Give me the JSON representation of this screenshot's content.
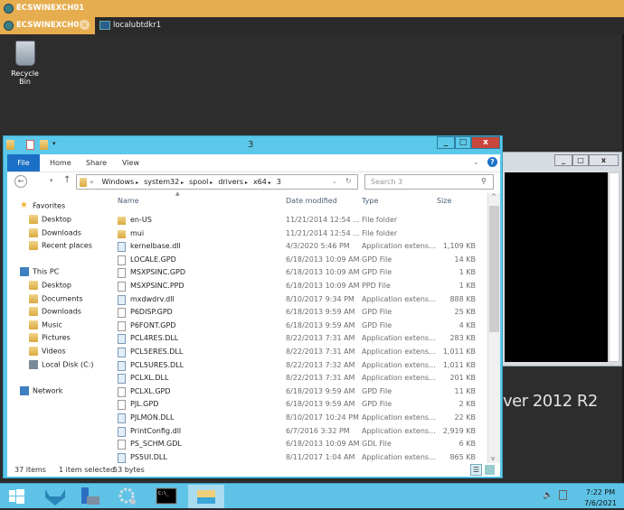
{
  "rdp": {
    "title": "ECSWINEXCH01",
    "tabs": [
      {
        "label": "ECSWINEXCH01",
        "active": true
      },
      {
        "label": "localubtdkr1",
        "active": false
      }
    ]
  },
  "desktop": {
    "recycle_bin": "Recycle Bin",
    "bg_text": "ver 2012 R2"
  },
  "explorer": {
    "title": "3",
    "ribbon": {
      "file": "File",
      "tabs": [
        "Home",
        "Share",
        "View"
      ]
    },
    "breadcrumb": [
      "Windows",
      "system32",
      "spool",
      "drivers",
      "x64",
      "3"
    ],
    "breadcrumb_prefix": "«",
    "search_placeholder": "Search 3",
    "nav": {
      "favorites": {
        "label": "Favorites",
        "items": [
          "Desktop",
          "Downloads",
          "Recent places"
        ]
      },
      "this_pc": {
        "label": "This PC",
        "items": [
          "Desktop",
          "Documents",
          "Downloads",
          "Music",
          "Pictures",
          "Videos",
          "Local Disk (C:)"
        ]
      },
      "network": "Network"
    },
    "columns": {
      "name": "Name",
      "date": "Date modified",
      "type": "Type",
      "size": "Size"
    },
    "files": [
      {
        "name": "en-US",
        "date": "11/21/2014 12:54 ...",
        "type": "File folder",
        "size": "",
        "icon": "folder"
      },
      {
        "name": "mui",
        "date": "11/21/2014 12:54 ...",
        "type": "File folder",
        "size": "",
        "icon": "folder"
      },
      {
        "name": "kernelbase.dll",
        "date": "4/3/2020 5:46 PM",
        "type": "Application extens...",
        "size": "1,109 KB",
        "icon": "dll"
      },
      {
        "name": "LOCALE.GPD",
        "date": "6/18/2013 10:09 AM",
        "type": "GPD File",
        "size": "14 KB",
        "icon": "file"
      },
      {
        "name": "MSXPSINC.GPD",
        "date": "6/18/2013 10:09 AM",
        "type": "GPD File",
        "size": "1 KB",
        "icon": "file"
      },
      {
        "name": "MSXPSINC.PPD",
        "date": "6/18/2013 10:09 AM",
        "type": "PPD File",
        "size": "1 KB",
        "icon": "file"
      },
      {
        "name": "mxdwdrv.dll",
        "date": "8/10/2017 9:34 PM",
        "type": "Application extens...",
        "size": "888 KB",
        "icon": "dll"
      },
      {
        "name": "P6DISP.GPD",
        "date": "6/18/2013 9:59 AM",
        "type": "GPD File",
        "size": "25 KB",
        "icon": "file"
      },
      {
        "name": "P6FONT.GPD",
        "date": "6/18/2013 9:59 AM",
        "type": "GPD File",
        "size": "4 KB",
        "icon": "file"
      },
      {
        "name": "PCL4RES.DLL",
        "date": "8/22/2013 7:31 AM",
        "type": "Application extens...",
        "size": "283 KB",
        "icon": "dll"
      },
      {
        "name": "PCL5ERES.DLL",
        "date": "8/22/2013 7:31 AM",
        "type": "Application extens...",
        "size": "1,011 KB",
        "icon": "dll"
      },
      {
        "name": "PCL5URES.DLL",
        "date": "8/22/2013 7:32 AM",
        "type": "Application extens...",
        "size": "1,011 KB",
        "icon": "dll"
      },
      {
        "name": "PCLXL.DLL",
        "date": "8/22/2013 7:31 AM",
        "type": "Application extens...",
        "size": "201 KB",
        "icon": "dll"
      },
      {
        "name": "PCLXL.GPD",
        "date": "6/18/2013 9:59 AM",
        "type": "GPD File",
        "size": "11 KB",
        "icon": "file"
      },
      {
        "name": "PJL.GPD",
        "date": "6/18/2013 9:59 AM",
        "type": "GPD File",
        "size": "2 KB",
        "icon": "file"
      },
      {
        "name": "PJLMON.DLL",
        "date": "8/10/2017 10:24 PM",
        "type": "Application extens...",
        "size": "22 KB",
        "icon": "dll"
      },
      {
        "name": "PrintConfig.dll",
        "date": "6/7/2016 3:32 PM",
        "type": "Application extens...",
        "size": "2,919 KB",
        "icon": "dll"
      },
      {
        "name": "PS_SCHM.GDL",
        "date": "6/18/2013 10:09 AM",
        "type": "GDL File",
        "size": "6 KB",
        "icon": "file"
      },
      {
        "name": "PS5UI.DLL",
        "date": "8/11/2017 1:04 AM",
        "type": "Application extens...",
        "size": "865 KB",
        "icon": "dll"
      }
    ],
    "status": {
      "items": "37 items",
      "selected": "1 item selected",
      "size": "53 bytes"
    }
  },
  "taskbar": {
    "time": "7:22 PM",
    "date": "7/6/2021",
    "apps": [
      "start",
      "gitlab",
      "server-manager",
      "settings",
      "command-prompt",
      "file-explorer"
    ],
    "active_app": "file-explorer"
  },
  "colors": {
    "rdp_accent": "#e6ad4f",
    "window_frame": "#5bc8ea",
    "file_tab": "#1b6fc6",
    "close": "#c9463d",
    "taskbar": "#5ec3e6"
  }
}
